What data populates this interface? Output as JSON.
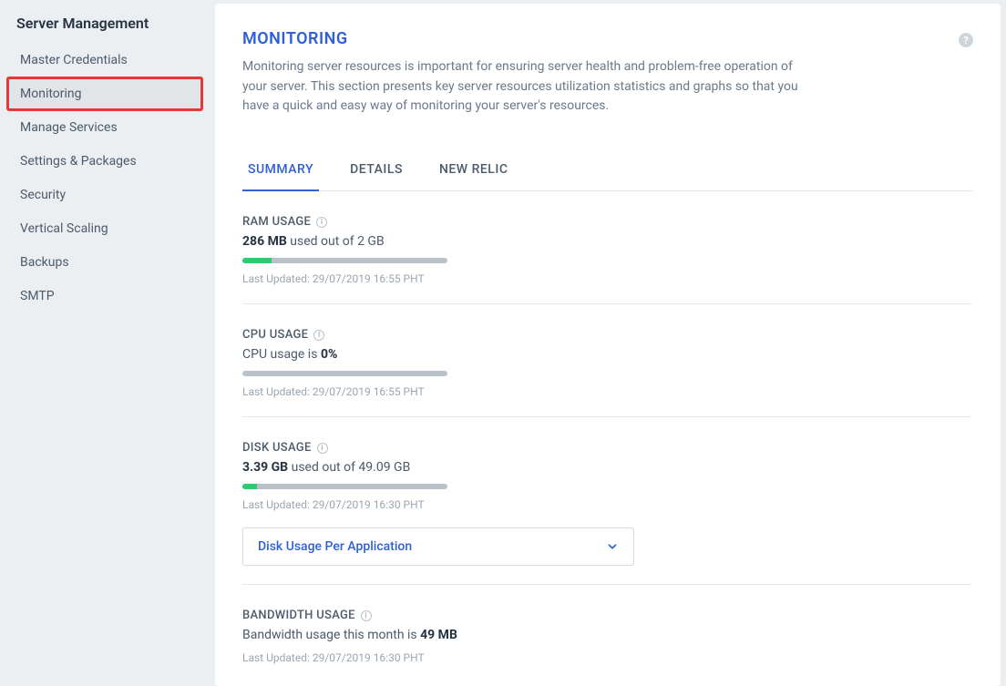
{
  "sidebar": {
    "title": "Server Management",
    "items": [
      {
        "label": "Master Credentials",
        "active": false,
        "highlight": false
      },
      {
        "label": "Monitoring",
        "active": true,
        "highlight": true
      },
      {
        "label": "Manage Services",
        "active": false,
        "highlight": false
      },
      {
        "label": "Settings & Packages",
        "active": false,
        "highlight": false
      },
      {
        "label": "Security",
        "active": false,
        "highlight": false
      },
      {
        "label": "Vertical Scaling",
        "active": false,
        "highlight": false
      },
      {
        "label": "Backups",
        "active": false,
        "highlight": false
      },
      {
        "label": "SMTP",
        "active": false,
        "highlight": false
      }
    ]
  },
  "page": {
    "title": "MONITORING",
    "description": "Monitoring server resources is important for ensuring server health and problem-free operation of your server. This section presents key server resources utilization statistics and graphs so that you have a quick and easy way of monitoring your server's resources."
  },
  "tabs": [
    {
      "label": "SUMMARY",
      "active": true
    },
    {
      "label": "DETAILS",
      "active": false
    },
    {
      "label": "NEW RELIC",
      "active": false
    }
  ],
  "metrics": {
    "ram": {
      "title": "RAM USAGE",
      "value": "286 MB",
      "suffix": "used out of 2 GB",
      "percent": 14,
      "updated_prefix": "Last Updated:",
      "updated": "29/07/2019 16:55 PHT"
    },
    "cpu": {
      "title": "CPU USAGE",
      "prefix": "CPU usage is",
      "value": "0%",
      "percent": 0,
      "updated_prefix": "Last Updated:",
      "updated": "29/07/2019 16:55 PHT"
    },
    "disk": {
      "title": "DISK USAGE",
      "value": "3.39 GB",
      "suffix": "used out of 49.09 GB",
      "percent": 7,
      "updated_prefix": "Last Updated:",
      "updated": "29/07/2019 16:30 PHT",
      "expand_label": "Disk Usage Per Application"
    },
    "bandwidth": {
      "title": "BANDWIDTH USAGE",
      "prefix": "Bandwidth usage this month is",
      "value": "49 MB",
      "updated_prefix": "Last Updated:",
      "updated": "29/07/2019 16:30 PHT"
    }
  }
}
